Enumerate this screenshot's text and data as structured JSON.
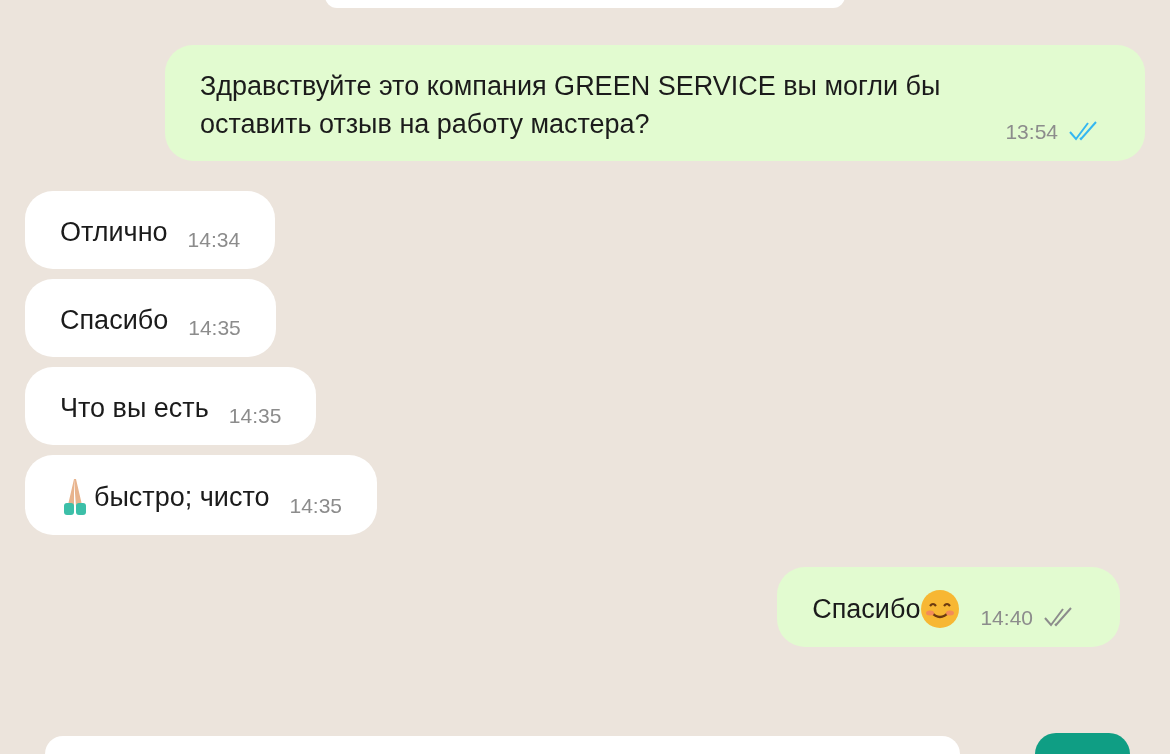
{
  "messages": [
    {
      "kind": "outgoing",
      "content": [
        {
          "kind": "text",
          "text": "Здравствуйте это компания GREEN SERVICE вы могли бы оставить отзыв на работу мастера?"
        }
      ],
      "time": "13:54",
      "read": true
    },
    {
      "kind": "incoming",
      "content": [
        {
          "kind": "text",
          "text": "Отлично"
        }
      ],
      "time": "14:34"
    },
    {
      "kind": "incoming",
      "content": [
        {
          "kind": "text",
          "text": "Спасибо"
        }
      ],
      "time": "14:35"
    },
    {
      "kind": "incoming",
      "content": [
        {
          "kind": "text",
          "text": "Что вы есть"
        }
      ],
      "time": "14:35"
    },
    {
      "kind": "incoming",
      "content": [
        {
          "kind": "praying"
        },
        {
          "kind": "text",
          "text": "быстро; чисто"
        }
      ],
      "time": "14:35"
    },
    {
      "kind": "outgoing",
      "content": [
        {
          "kind": "text",
          "text": "Спасибо"
        },
        {
          "kind": "smile"
        }
      ],
      "time": "14:40",
      "read": false
    }
  ]
}
